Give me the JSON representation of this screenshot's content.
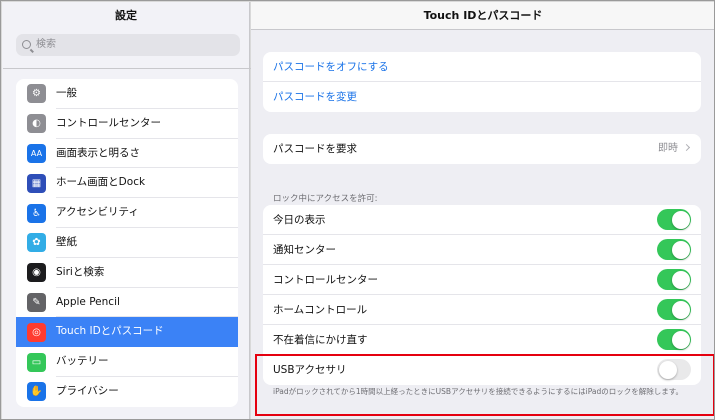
{
  "sidebar": {
    "title": "設定",
    "search_placeholder": "検索",
    "items": [
      {
        "label": "一般",
        "icon": "gear-icon",
        "color": "#8e8e93",
        "glyph": "⚙"
      },
      {
        "label": "コントロールセンター",
        "icon": "toggles-icon",
        "color": "#8e8e93",
        "glyph": "◐"
      },
      {
        "label": "画面表示と明るさ",
        "icon": "display-brightness-icon",
        "color": "#1a73e8",
        "glyph": "AA"
      },
      {
        "label": "ホーム画面とDock",
        "icon": "home-screen-icon",
        "color": "#2e4eb8",
        "glyph": "▦"
      },
      {
        "label": "アクセシビリティ",
        "icon": "accessibility-icon",
        "color": "#1a73e8",
        "glyph": "♿"
      },
      {
        "label": "壁紙",
        "icon": "wallpaper-icon",
        "color": "#32ade6",
        "glyph": "✿"
      },
      {
        "label": "Siriと検索",
        "icon": "siri-icon",
        "color": "#1c1c1e",
        "glyph": "◉"
      },
      {
        "label": "Apple Pencil",
        "icon": "pencil-icon",
        "color": "#636366",
        "glyph": "✎"
      },
      {
        "label": "Touch IDとパスコード",
        "icon": "fingerprint-icon",
        "color": "#ff3b30",
        "glyph": "◎"
      },
      {
        "label": "バッテリー",
        "icon": "battery-icon",
        "color": "#34c759",
        "glyph": "▭"
      },
      {
        "label": "プライバシー",
        "icon": "hand-icon",
        "color": "#1a73e8",
        "glyph": "✋"
      }
    ],
    "active_index": 8
  },
  "main": {
    "title": "Touch IDとパスコード",
    "passcode_off": "パスコードをオフにする",
    "passcode_change": "パスコードを変更",
    "require_label": "パスコードを要求",
    "require_value": "即時",
    "locked_access_label": "ロック中にアクセスを許可:",
    "toggles": [
      {
        "label": "今日の表示",
        "on": true
      },
      {
        "label": "通知センター",
        "on": true
      },
      {
        "label": "コントロールセンター",
        "on": true
      },
      {
        "label": "ホームコントロール",
        "on": true
      },
      {
        "label": "不在着信にかけ直す",
        "on": true
      },
      {
        "label": "USBアクセサリ",
        "on": false
      }
    ],
    "footer": "iPadがロックされてから1時間以上経ったときにUSBアクセサリを接続できるようにするにはiPadのロックを解除します。"
  },
  "colors": {
    "accent": "#1a73e8",
    "toggle_on": "#34c759",
    "highlight": "#e5000f",
    "active_row": "#3b82f6"
  }
}
